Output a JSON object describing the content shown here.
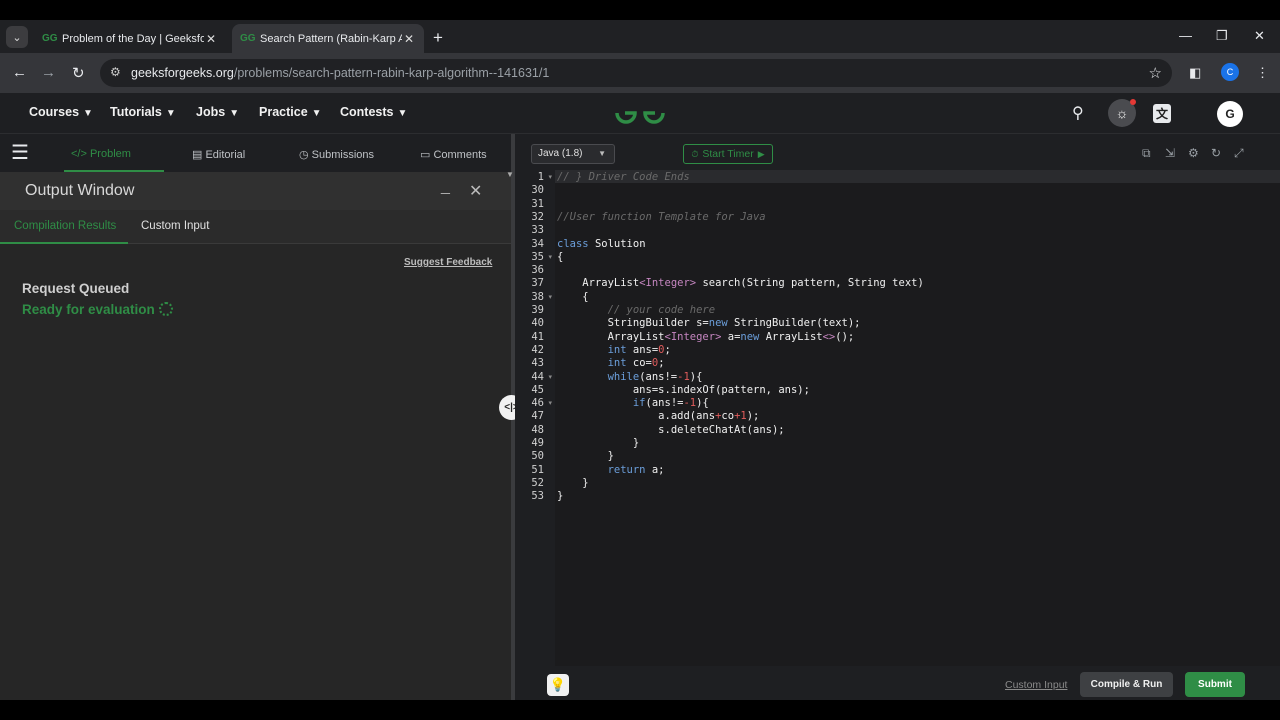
{
  "browser": {
    "tabs": [
      {
        "title": "Problem of the Day | GeeksforG",
        "active": false
      },
      {
        "title": "Search Pattern (Rabin-Karp Alg",
        "active": true
      }
    ],
    "url_domain": "geeksforgeeks.org",
    "url_path": "/problems/search-pattern-rabin-karp-algorithm--141631/1",
    "profile_initial": "C"
  },
  "site_header": {
    "menu": [
      "Courses",
      "Tutorials",
      "Jobs",
      "Practice",
      "Contests"
    ],
    "avatar_initial": "G"
  },
  "left_tabs": [
    "Problem",
    "Editorial",
    "Submissions",
    "Comments"
  ],
  "output_window": {
    "title": "Output Window",
    "tabs": [
      "Compilation Results",
      "Custom Input"
    ],
    "suggest_feedback": "Suggest Feedback",
    "status": "Request Queued",
    "ready": "Ready for evaluation"
  },
  "editor": {
    "language": "Java (1.8)",
    "timer_label": "Start Timer",
    "line_numbers": [
      "1",
      "30",
      "31",
      "32",
      "33",
      "34",
      "35",
      "36",
      "37",
      "38",
      "39",
      "40",
      "41",
      "42",
      "43",
      "44",
      "45",
      "46",
      "47",
      "48",
      "49",
      "50",
      "51",
      "52",
      "53"
    ],
    "code_lines": [
      "// } Driver Code Ends",
      "",
      "",
      "//User function Template for Java",
      "",
      "class Solution",
      "{",
      "",
      "    ArrayList<Integer> search(String pattern, String text)",
      "    {",
      "        // your code here",
      "        StringBuilder s=new StringBuilder(text);",
      "        ArrayList<Integer> a=new ArrayList<>();",
      "        int ans=0;",
      "        int co=0;",
      "        while(ans!=-1){",
      "            ans=s.indexOf(pattern, ans);",
      "            if(ans!=-1){",
      "                a.add(ans+co+1);",
      "                s.deleteChatAt(ans);",
      "            }",
      "        }",
      "        return a;",
      "    }",
      "}"
    ],
    "custom_input_label": "Custom Input",
    "compile_label": "Compile & Run",
    "submit_label": "Submit"
  },
  "colors": {
    "brand_green": "#2f8d46",
    "keyword": "#6b9eda",
    "type": "#c586c0",
    "comment": "#6a6a6a",
    "number": "#e05c5c"
  }
}
